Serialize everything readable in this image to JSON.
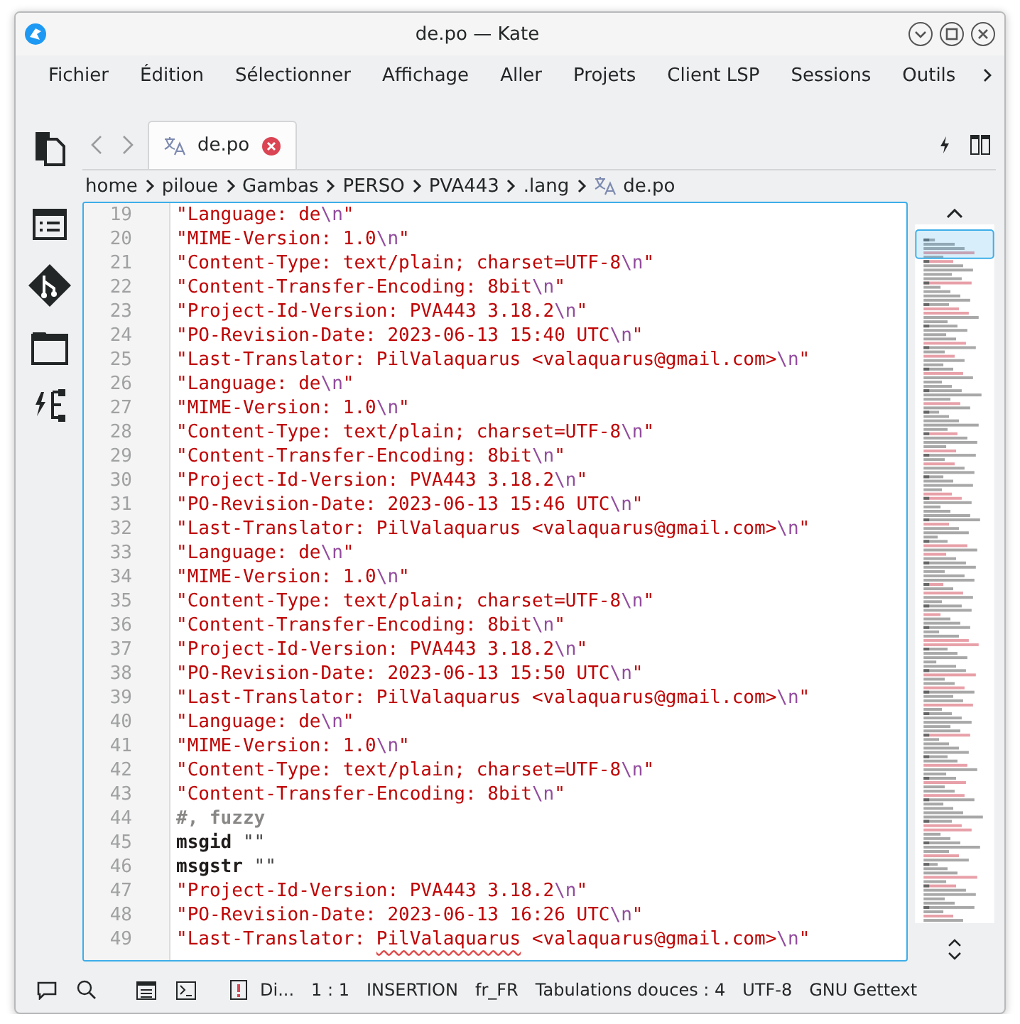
{
  "window": {
    "title": "de.po — Kate"
  },
  "menu": [
    "Fichier",
    "Édition",
    "Sélectionner",
    "Affichage",
    "Aller",
    "Projets",
    "Client LSP",
    "Sessions",
    "Outils"
  ],
  "tabs": [
    {
      "label": "de.po",
      "selected": true
    }
  ],
  "breadcrumb": [
    "home",
    "piloue",
    "Gambas",
    "PERSO",
    "PVA443",
    ".lang",
    "de.po"
  ],
  "editor": {
    "lines": [
      {
        "number": "19",
        "tokens": [
          {
            "kind": "string",
            "text": "\"Language: de"
          },
          {
            "kind": "escape",
            "text": "\\n"
          },
          {
            "kind": "string",
            "text": "\""
          }
        ]
      },
      {
        "number": "20",
        "tokens": [
          {
            "kind": "string",
            "text": "\"MIME-Version: 1.0"
          },
          {
            "kind": "escape",
            "text": "\\n"
          },
          {
            "kind": "string",
            "text": "\""
          }
        ]
      },
      {
        "number": "21",
        "tokens": [
          {
            "kind": "string",
            "text": "\"Content-Type: text/plain; charset=UTF-8"
          },
          {
            "kind": "escape",
            "text": "\\n"
          },
          {
            "kind": "string",
            "text": "\""
          }
        ]
      },
      {
        "number": "22",
        "tokens": [
          {
            "kind": "string",
            "text": "\"Content-Transfer-Encoding: 8bit"
          },
          {
            "kind": "escape",
            "text": "\\n"
          },
          {
            "kind": "string",
            "text": "\""
          }
        ]
      },
      {
        "number": "23",
        "tokens": [
          {
            "kind": "string",
            "text": "\"Project-Id-Version: PVA443 3.18.2"
          },
          {
            "kind": "escape",
            "text": "\\n"
          },
          {
            "kind": "string",
            "text": "\""
          }
        ]
      },
      {
        "number": "24",
        "tokens": [
          {
            "kind": "string",
            "text": "\"PO-Revision-Date: 2023-06-13 15:40 UTC"
          },
          {
            "kind": "escape",
            "text": "\\n"
          },
          {
            "kind": "string",
            "text": "\""
          }
        ]
      },
      {
        "number": "25",
        "tokens": [
          {
            "kind": "string",
            "text": "\"Last-Translator: PilValaquarus <valaquarus@gmail.com>"
          },
          {
            "kind": "escape",
            "text": "\\n"
          },
          {
            "kind": "string",
            "text": "\""
          }
        ]
      },
      {
        "number": "26",
        "tokens": [
          {
            "kind": "string",
            "text": "\"Language: de"
          },
          {
            "kind": "escape",
            "text": "\\n"
          },
          {
            "kind": "string",
            "text": "\""
          }
        ]
      },
      {
        "number": "27",
        "tokens": [
          {
            "kind": "string",
            "text": "\"MIME-Version: 1.0"
          },
          {
            "kind": "escape",
            "text": "\\n"
          },
          {
            "kind": "string",
            "text": "\""
          }
        ]
      },
      {
        "number": "28",
        "tokens": [
          {
            "kind": "string",
            "text": "\"Content-Type: text/plain; charset=UTF-8"
          },
          {
            "kind": "escape",
            "text": "\\n"
          },
          {
            "kind": "string",
            "text": "\""
          }
        ]
      },
      {
        "number": "29",
        "tokens": [
          {
            "kind": "string",
            "text": "\"Content-Transfer-Encoding: 8bit"
          },
          {
            "kind": "escape",
            "text": "\\n"
          },
          {
            "kind": "string",
            "text": "\""
          }
        ]
      },
      {
        "number": "30",
        "tokens": [
          {
            "kind": "string",
            "text": "\"Project-Id-Version: PVA443 3.18.2"
          },
          {
            "kind": "escape",
            "text": "\\n"
          },
          {
            "kind": "string",
            "text": "\""
          }
        ]
      },
      {
        "number": "31",
        "tokens": [
          {
            "kind": "string",
            "text": "\"PO-Revision-Date: 2023-06-13 15:46 UTC"
          },
          {
            "kind": "escape",
            "text": "\\n"
          },
          {
            "kind": "string",
            "text": "\""
          }
        ]
      },
      {
        "number": "32",
        "tokens": [
          {
            "kind": "string",
            "text": "\"Last-Translator: PilValaquarus <valaquarus@gmail.com>"
          },
          {
            "kind": "escape",
            "text": "\\n"
          },
          {
            "kind": "string",
            "text": "\""
          }
        ]
      },
      {
        "number": "33",
        "tokens": [
          {
            "kind": "string",
            "text": "\"Language: de"
          },
          {
            "kind": "escape",
            "text": "\\n"
          },
          {
            "kind": "string",
            "text": "\""
          }
        ]
      },
      {
        "number": "34",
        "tokens": [
          {
            "kind": "string",
            "text": "\"MIME-Version: 1.0"
          },
          {
            "kind": "escape",
            "text": "\\n"
          },
          {
            "kind": "string",
            "text": "\""
          }
        ]
      },
      {
        "number": "35",
        "tokens": [
          {
            "kind": "string",
            "text": "\"Content-Type: text/plain; charset=UTF-8"
          },
          {
            "kind": "escape",
            "text": "\\n"
          },
          {
            "kind": "string",
            "text": "\""
          }
        ]
      },
      {
        "number": "36",
        "tokens": [
          {
            "kind": "string",
            "text": "\"Content-Transfer-Encoding: 8bit"
          },
          {
            "kind": "escape",
            "text": "\\n"
          },
          {
            "kind": "string",
            "text": "\""
          }
        ]
      },
      {
        "number": "37",
        "tokens": [
          {
            "kind": "string",
            "text": "\"Project-Id-Version: PVA443 3.18.2"
          },
          {
            "kind": "escape",
            "text": "\\n"
          },
          {
            "kind": "string",
            "text": "\""
          }
        ]
      },
      {
        "number": "38",
        "tokens": [
          {
            "kind": "string",
            "text": "\"PO-Revision-Date: 2023-06-13 15:50 UTC"
          },
          {
            "kind": "escape",
            "text": "\\n"
          },
          {
            "kind": "string",
            "text": "\""
          }
        ]
      },
      {
        "number": "39",
        "tokens": [
          {
            "kind": "string",
            "text": "\"Last-Translator: PilValaquarus <valaquarus@gmail.com>"
          },
          {
            "kind": "escape",
            "text": "\\n"
          },
          {
            "kind": "string",
            "text": "\""
          }
        ]
      },
      {
        "number": "40",
        "tokens": [
          {
            "kind": "string",
            "text": "\"Language: de"
          },
          {
            "kind": "escape",
            "text": "\\n"
          },
          {
            "kind": "string",
            "text": "\""
          }
        ]
      },
      {
        "number": "41",
        "tokens": [
          {
            "kind": "string",
            "text": "\"MIME-Version: 1.0"
          },
          {
            "kind": "escape",
            "text": "\\n"
          },
          {
            "kind": "string",
            "text": "\""
          }
        ]
      },
      {
        "number": "42",
        "tokens": [
          {
            "kind": "string",
            "text": "\"Content-Type: text/plain; charset=UTF-8"
          },
          {
            "kind": "escape",
            "text": "\\n"
          },
          {
            "kind": "string",
            "text": "\""
          }
        ]
      },
      {
        "number": "43",
        "tokens": [
          {
            "kind": "string",
            "text": "\"Content-Transfer-Encoding: 8bit"
          },
          {
            "kind": "escape",
            "text": "\\n"
          },
          {
            "kind": "string",
            "text": "\""
          }
        ]
      },
      {
        "number": "44",
        "tokens": [
          {
            "kind": "comment",
            "text": "#, fuzzy"
          }
        ]
      },
      {
        "number": "45",
        "tokens": [
          {
            "kind": "keyword",
            "text": "msgid"
          },
          {
            "kind": "plain",
            "text": " \"\""
          }
        ]
      },
      {
        "number": "46",
        "tokens": [
          {
            "kind": "keyword",
            "text": "msgstr"
          },
          {
            "kind": "plain",
            "text": " \"\""
          }
        ]
      },
      {
        "number": "47",
        "tokens": [
          {
            "kind": "string",
            "text": "\"Project-Id-Version: PVA443 3.18.2"
          },
          {
            "kind": "escape",
            "text": "\\n"
          },
          {
            "kind": "string",
            "text": "\""
          }
        ]
      },
      {
        "number": "48",
        "tokens": [
          {
            "kind": "string",
            "text": "\"PO-Revision-Date: 2023-06-13 16:26 UTC"
          },
          {
            "kind": "escape",
            "text": "\\n"
          },
          {
            "kind": "string",
            "text": "\""
          }
        ]
      },
      {
        "number": "49",
        "tokens": [
          {
            "kind": "string",
            "text": "\"Last-Translator: "
          },
          {
            "kind": "misspelled",
            "text": "PilValaquarus"
          },
          {
            "kind": "string",
            "text": " <valaquarus@gmail.com>"
          },
          {
            "kind": "escape",
            "text": "\\n"
          },
          {
            "kind": "string",
            "text": "\""
          }
        ]
      }
    ]
  },
  "status_bar": {
    "diagnostics": "Di...",
    "cursor": "1 : 1",
    "mode": "INSERTION",
    "language": "fr_FR",
    "indent": "Tabulations douces : 4",
    "encoding": "UTF-8",
    "syntax": "GNU Gettext"
  }
}
